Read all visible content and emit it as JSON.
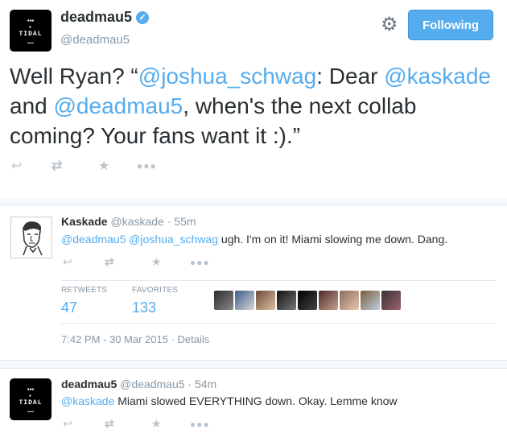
{
  "main_tweet": {
    "avatar_text": "TIDAL",
    "name": "deadmau5",
    "handle": "@deadmau5",
    "follow_label": "Following",
    "text_part1": "Well Ryan? “",
    "mention1": "@joshua_schwag",
    "text_part2": ": Dear ",
    "mention2": "@kaskade",
    "text_part3": " and ",
    "mention3": "@deadmau5",
    "text_part4": ", when's the next collab coming? Your fans want it :).”"
  },
  "reply1": {
    "name": "Kaskade",
    "handle": "@kaskade",
    "time": "· 55m",
    "mention1": "@deadmau5",
    "mention2": "@joshua_schwag",
    "text": " ugh. I'm on it! Miami slowing me down. Dang.",
    "retweets_label": "RETWEETS",
    "retweets": "47",
    "favorites_label": "FAVORITES",
    "favorites": "133",
    "timestamp": "7:42 PM - 30 Mar 2015",
    "details": "· Details"
  },
  "reply2": {
    "avatar_text": "TIDAL",
    "name": "deadmau5",
    "handle": "@deadmau5",
    "time": "· 54m",
    "mention1": "@kaskade",
    "text": " Miami slowed EVERYTHING down. Okay. Lemme know"
  },
  "icons": {
    "reply": "reply-icon",
    "retweet": "retweet-icon",
    "favorite": "star-icon",
    "more": "more-icon",
    "gear": "gear-icon",
    "verified": "verified-badge-icon"
  },
  "colors": {
    "accent": "#55acee",
    "text": "#292f33",
    "muted": "#8899a6",
    "action": "#bbc4cc"
  }
}
